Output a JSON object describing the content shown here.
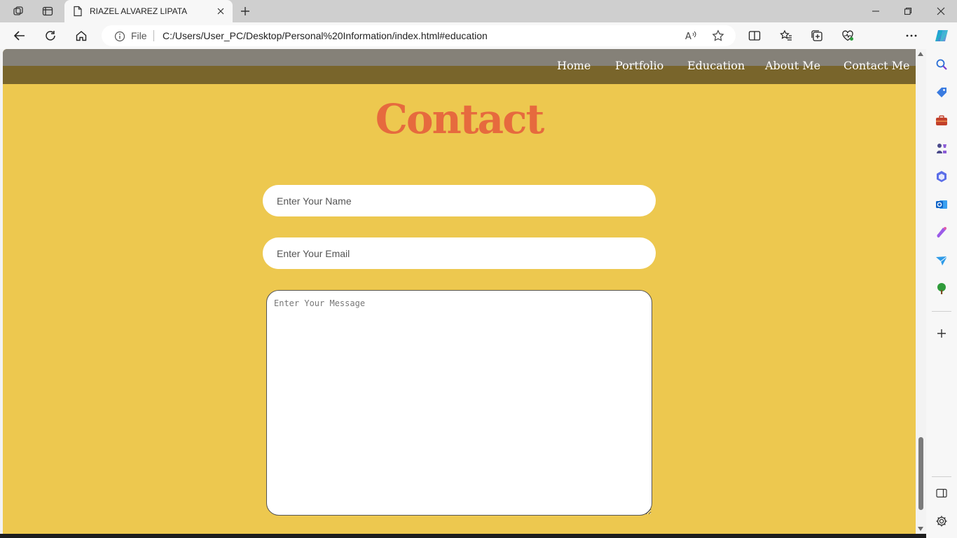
{
  "browser": {
    "tab_title": "RIAZEL ALVAREZ LIPATA",
    "address": {
      "scheme_label": "File",
      "url": "C:/Users/User_PC/Desktop/Personal%20Information/index.html#education"
    }
  },
  "site": {
    "nav": [
      "Home",
      "Portfolio",
      "Education",
      "About Me",
      "Contact Me"
    ],
    "colors": {
      "background": "#edc84f",
      "navbar": "#79652b",
      "title": "#e66a3e"
    }
  },
  "contact": {
    "title": "Contact",
    "name_placeholder": "Enter Your Name",
    "email_placeholder": "Enter Your Email",
    "message_placeholder": "Enter Your Message"
  }
}
